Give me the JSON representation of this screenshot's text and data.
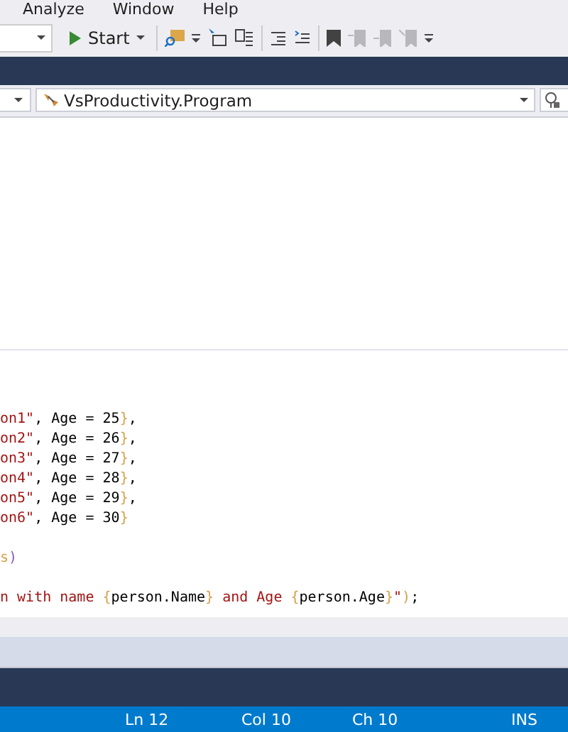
{
  "menu": [
    {
      "label": "Analyze"
    },
    {
      "label": "Window"
    },
    {
      "label": "Help"
    }
  ],
  "toolbar": {
    "start_button": "Start"
  },
  "nav_bar": {
    "type_dropdown": "VsProductivity.Program"
  },
  "code_lines": [
    {
      "kind": "blank"
    },
    {
      "kind": "code",
      "tokens": [
        {
          "kind": "string",
          "text": "on1\""
        },
        {
          "kind": "plain",
          "text": ", Age = 25"
        },
        {
          "kind": "brace",
          "text": "}"
        },
        {
          "kind": "plain",
          "text": ","
        }
      ]
    },
    {
      "kind": "code",
      "tokens": [
        {
          "kind": "string",
          "text": "on2\""
        },
        {
          "kind": "plain",
          "text": ", Age = 26"
        },
        {
          "kind": "brace",
          "text": "}"
        },
        {
          "kind": "plain",
          "text": ","
        }
      ]
    },
    {
      "kind": "code",
      "tokens": [
        {
          "kind": "string",
          "text": "on3\""
        },
        {
          "kind": "plain",
          "text": ", Age = 27"
        },
        {
          "kind": "brace",
          "text": "}"
        },
        {
          "kind": "plain",
          "text": ","
        }
      ]
    },
    {
      "kind": "code",
      "tokens": [
        {
          "kind": "string",
          "text": "on4\""
        },
        {
          "kind": "plain",
          "text": ", Age = 28"
        },
        {
          "kind": "brace",
          "text": "}"
        },
        {
          "kind": "plain",
          "text": ","
        }
      ]
    },
    {
      "kind": "code",
      "tokens": [
        {
          "kind": "string",
          "text": "on5\""
        },
        {
          "kind": "plain",
          "text": ", Age = 29"
        },
        {
          "kind": "brace",
          "text": "}"
        },
        {
          "kind": "plain",
          "text": ","
        }
      ]
    },
    {
      "kind": "code",
      "tokens": [
        {
          "kind": "string",
          "text": "on6\""
        },
        {
          "kind": "plain",
          "text": ", Age = 30"
        },
        {
          "kind": "brace",
          "text": "}"
        }
      ]
    },
    {
      "kind": "blank"
    },
    {
      "kind": "code",
      "tokens": [
        {
          "kind": "brace",
          "text": "s"
        },
        {
          "kind": "paren",
          "text": ")"
        }
      ]
    },
    {
      "kind": "blank"
    },
    {
      "kind": "code",
      "tokens": [
        {
          "kind": "string",
          "text": "n with name "
        },
        {
          "kind": "brace",
          "text": "{"
        },
        {
          "kind": "plain",
          "text": "person.Name"
        },
        {
          "kind": "brace",
          "text": "}"
        },
        {
          "kind": "string",
          "text": " and Age "
        },
        {
          "kind": "brace",
          "text": "{"
        },
        {
          "kind": "plain",
          "text": "person.Age"
        },
        {
          "kind": "brace",
          "text": "}"
        },
        {
          "kind": "string",
          "text": "\""
        },
        {
          "kind": "brace",
          "text": ")"
        },
        {
          "kind": "plain",
          "text": ";"
        }
      ]
    }
  ],
  "status_bar": {
    "line": "Ln 12",
    "column": "Col 10",
    "char": "Ch 10",
    "mode": "INS"
  }
}
